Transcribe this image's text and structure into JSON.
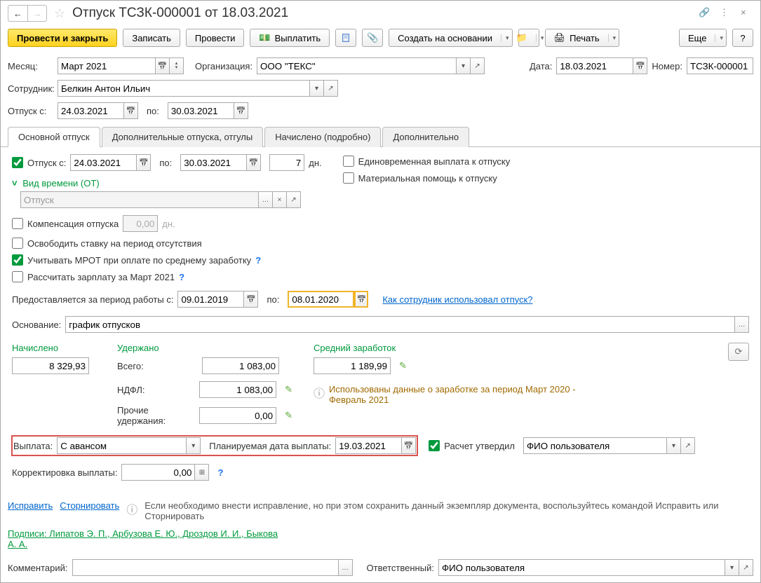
{
  "title": "Отпуск ТСЗК-000001 от 18.03.2021",
  "toolbar": {
    "post_close": "Провести и закрыть",
    "save": "Записать",
    "post": "Провести",
    "pay": "Выплатить",
    "create_based": "Создать на основании",
    "print": "Печать",
    "more": "Еще"
  },
  "fields": {
    "month_lbl": "Месяц:",
    "month": "Март 2021",
    "org_lbl": "Организация:",
    "org": "ООО \"ТЕКС\"",
    "date_lbl": "Дата:",
    "date": "18.03.2021",
    "num_lbl": "Номер:",
    "num": "ТСЗК-000001",
    "emp_lbl": "Сотрудник:",
    "emp": "Белкин Антон Ильич",
    "vac_from_lbl": "Отпуск с:",
    "vac_from": "24.03.2021",
    "vac_to_lbl": "по:",
    "vac_to": "30.03.2021"
  },
  "tabs": [
    "Основной отпуск",
    "Дополнительные отпуска, отгулы",
    "Начислено (подробно)",
    "Дополнительно"
  ],
  "main": {
    "vac_check": "Отпуск  с:",
    "vac_from": "24.03.2021",
    "vac_to_lbl": "по:",
    "vac_to": "30.03.2021",
    "days": "7",
    "days_lbl": "дн.",
    "onetime_pay": "Единовременная выплата к отпуску",
    "mat_help": "Материальная помощь к отпуску",
    "time_kind": "Вид времени (ОТ)",
    "time_kind_val": "Отпуск",
    "compensation": "Компенсация отпуска",
    "comp_val": "0,00",
    "comp_days": "дн.",
    "free_rate": "Освободить ставку на период отсутствия",
    "mrot": "Учитывать МРОТ при оплате по среднему заработку",
    "calc_salary": "Рассчитать зарплату за Март 2021",
    "period_lbl": "Предоставляется за период работы с:",
    "period_from": "09.01.2019",
    "period_to_lbl": "по:",
    "period_to": "08.01.2020",
    "how_used": "Как сотрудник использовал отпуск?",
    "basis_lbl": "Основание:",
    "basis": "график отпусков"
  },
  "totals": {
    "accrued_lbl": "Начислено",
    "accrued": "8 329,93",
    "withheld_lbl": "Удержано",
    "total_lbl": "Всего:",
    "total": "1 083,00",
    "ndfl_lbl": "НДФЛ:",
    "ndfl": "1 083,00",
    "other_lbl": "Прочие удержания:",
    "other": "0,00",
    "avg_lbl": "Средний заработок",
    "avg": "1 189,99",
    "info": "Использованы данные о заработке за период Март 2020 - Февраль 2021"
  },
  "payout": {
    "lbl": "Выплата:",
    "val": "С авансом",
    "plan_lbl": "Планируемая дата выплаты:",
    "plan_date": "19.03.2021",
    "approved": "Расчет утвердил",
    "approver": "ФИО пользователя",
    "corr_lbl": "Корректировка выплаты:",
    "corr_val": "0,00"
  },
  "footer": {
    "fix": "Исправить",
    "storno": "Сторнировать",
    "hint": "Если необходимо внести исправление, но при этом сохранить данный экземпляр документа, воспользуйтесь командой Исправить или Сторнировать",
    "signs": "Подписи: Липатов Э. П., Арбузова Е. Ю., Дроздов И. И., Быкова А. А.",
    "comment_lbl": "Комментарий:",
    "resp_lbl": "Ответственный:",
    "resp": "ФИО пользователя"
  }
}
